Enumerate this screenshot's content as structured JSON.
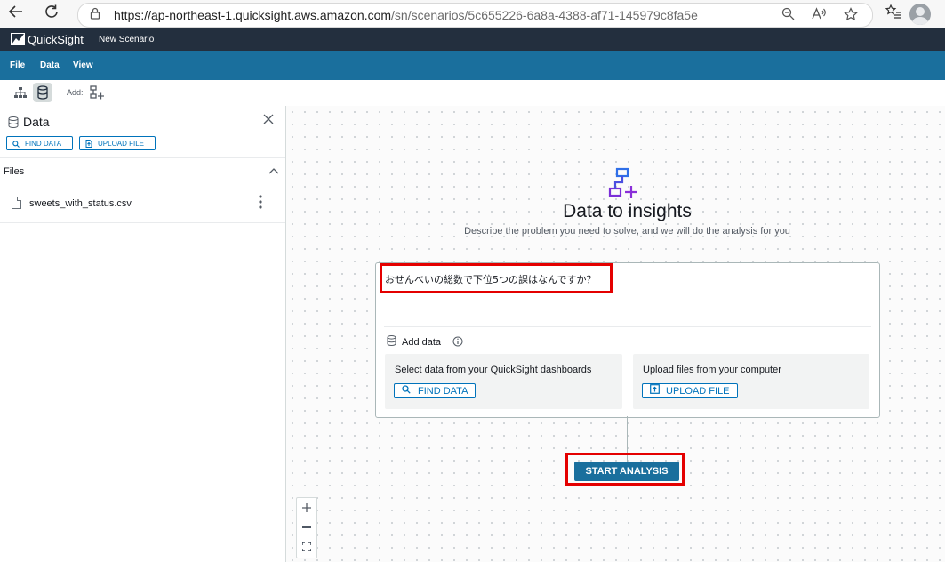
{
  "browser": {
    "url_host": "https://ap-northeast-1.quicksight.aws.amazon.com",
    "url_path": "/sn/scenarios/5c655226-6a8a-4388-af71-145979c8fa5e"
  },
  "header": {
    "brand": "QuickSight",
    "scenario_title": "New Scenario"
  },
  "menu": {
    "file": "File",
    "data": "Data",
    "view": "View"
  },
  "toolbar": {
    "add_label": "Add:"
  },
  "data_panel": {
    "title": "Data",
    "find_data": "FIND DATA",
    "upload_file": "UPLOAD FILE",
    "files_label": "Files",
    "files": [
      {
        "name": "sweets_with_status.csv"
      }
    ]
  },
  "canvas": {
    "title": "Data to insights",
    "subtitle": "Describe the problem you need to solve, and we will do the analysis for you",
    "question": "おせんべいの総数で下位5つの課はなんですか？",
    "add_data": "Add data",
    "select_dashboards": "Select data from your QuickSight dashboards",
    "find_data": "FIND DATA",
    "upload_from_computer": "Upload files from your computer",
    "upload_file": "UPLOAD FILE",
    "start_analysis": "START ANALYSIS"
  },
  "colors": {
    "accent": "#0073bb",
    "menubar": "#1a6f9d",
    "highlight": "#e40000"
  }
}
